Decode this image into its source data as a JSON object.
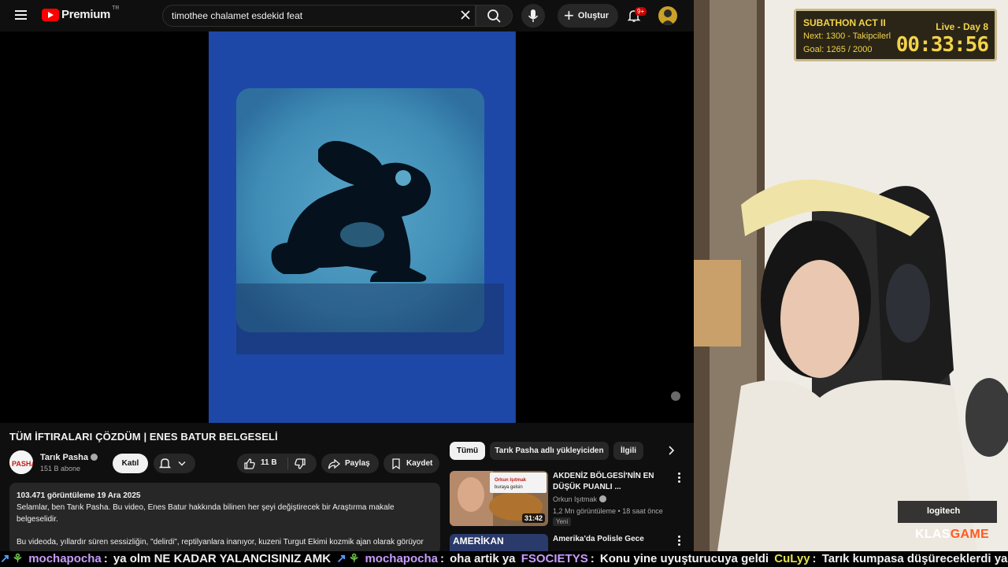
{
  "header": {
    "logo_text": "Premium",
    "logo_sup": "TR",
    "search_value": "timothee chalamet esdekid feat",
    "create_label": "Oluştur",
    "notifications_badge": "9+"
  },
  "video": {
    "title": "TÜM İFTIRALARI ÇÖZDÜM | ENES BATUR BELGESELİ",
    "channel_name": "Tarık Pasha",
    "subscribers": "151 B abone",
    "join_label": "Katıl",
    "like_count": "11 B",
    "share_label": "Paylaş",
    "save_label": "Kaydet",
    "views_date": "103.471 görüntüleme  19 Ara 2025",
    "description_1": "Selamlar, ben Tarık Pasha. Bu video, Enes Batur hakkında bilinen her şeyi değiştirecek bir Araştırma makale belgeselidir.",
    "description_2": "Bu videoda, yıllardır süren sessizliğin, \"delirdi\", reptilyanlara inanıyor, kuzeni Turgut Ekimi kozmik ajan olarak görüyor"
  },
  "chips": [
    "Tümü",
    "Tarık Pasha adlı yükleyiciden",
    "İlgili"
  ],
  "recommendations": [
    {
      "title": "AKDENİZ BÖLGESİ'NİN EN DÜŞÜK PUANLI ...",
      "channel": "Orkun Işıtmak",
      "meta": "1,2 Mn görüntüleme  •  18 saat önce",
      "badge": "Yeni",
      "duration": "31:42",
      "thumb_text": "Orkun Işıtmak buraya gelsin"
    },
    {
      "title": "Amerika'da Polisle Gece",
      "thumb_text": "AMERİKAN"
    }
  ],
  "overlay": {
    "title": "SUBATHON ACT II",
    "live": "Live - Day 8",
    "next": "Next: 1300 - Takipcilerl",
    "goal": "Goal: 1265 / 2000",
    "timer": "00:33:56"
  },
  "brand": {
    "logitech": "logitech",
    "klas_1": "KLAS",
    "klas_2": "GAME"
  },
  "chat": [
    {
      "user": "mochapocha",
      "user_color": "#c99cff",
      "msg": "ya olm NE KADAR YALANCISINIZ AMK"
    },
    {
      "user": "mochapocha",
      "user_color": "#c99cff",
      "msg": "oha artik ya"
    },
    {
      "user": "FSOCIETYS",
      "user_color": "#c99cff",
      "msg": "Konu yine uyuşturucuya geldi"
    },
    {
      "user": "CuLyy",
      "user_color": "#e3e34a",
      "msg": "Tarık kumpasa düşüreceklerdi yani"
    }
  ],
  "colors": {
    "accent_red": "#ff0000",
    "overlay_gold": "#f3d34a",
    "klas_orange": "#ff5a1f"
  }
}
